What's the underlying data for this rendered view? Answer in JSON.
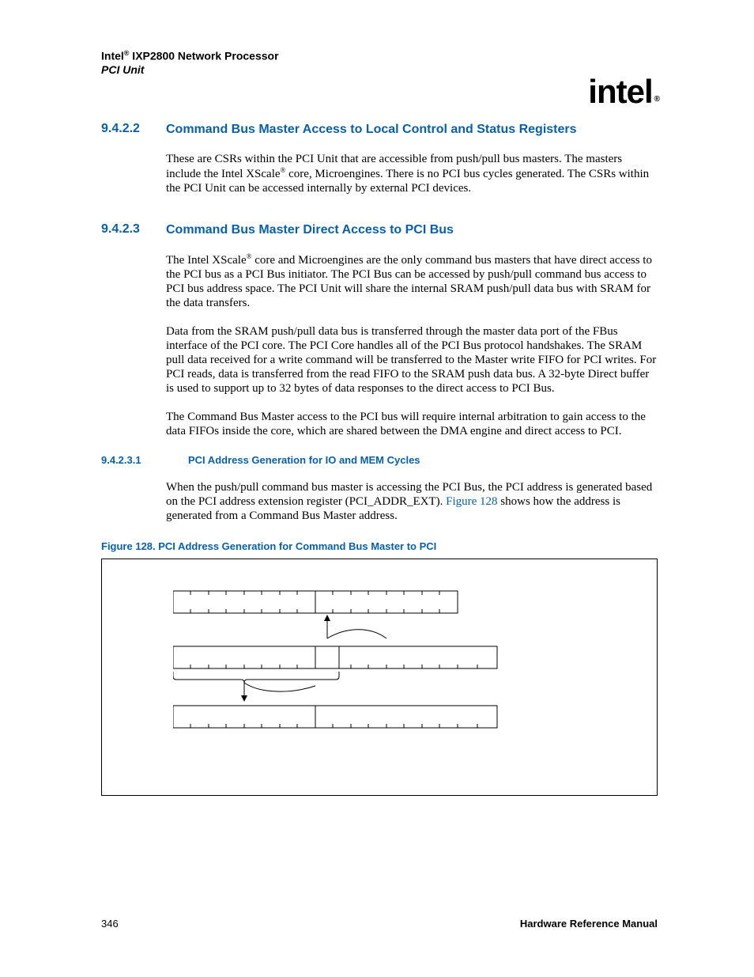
{
  "header": {
    "brand_prefix": "Intel",
    "reg_mark": "®",
    "product": " IXP2800 Network Processor",
    "subtitle": "PCI Unit"
  },
  "logo": {
    "text": "intel",
    "reg": "®"
  },
  "section_9422": {
    "num": "9.4.2.2",
    "title": "Command Bus Master Access to Local Control and Status Registers",
    "para1_a": "These are CSRs within the PCI Unit that are accessible from push/pull bus masters. The masters include the Intel XScale",
    "reg": "®",
    "para1_b": " core, Microengines. There is no PCI bus cycles generated. The CSRs within the PCI Unit can be accessed internally by external PCI devices."
  },
  "section_9423": {
    "num": "9.4.2.3",
    "title": "Command Bus Master Direct Access to PCI Bus",
    "para1_a": "The Intel XScale",
    "reg": "®",
    "para1_b": " core and Microengines are the only command bus masters that have direct access to the PCI bus as a PCI Bus initiator. The PCI Bus can be accessed by push/pull command bus access to PCI bus address space. The PCI Unit will share the internal SRAM push/pull data bus with SRAM for the data transfers.",
    "para2": "Data from the SRAM push/pull data bus is transferred through the master data port of the FBus interface of the PCI core. The PCI Core handles all of the PCI Bus protocol handshakes. The SRAM pull data received for a write command will be transferred to the Master write FIFO for PCI writes. For PCI reads, data is transferred from the read FIFO to the SRAM push data bus. A 32-byte Direct buffer is used to support up to 32 bytes of data responses to the direct access to PCI Bus.",
    "para3": "The Command Bus Master access to the PCI bus will require internal arbitration to gain access to the data FIFOs inside the core, which are shared between the DMA engine and direct access to PCI."
  },
  "section_94231": {
    "num": "9.4.2.3.1",
    "title": "PCI Address Generation for IO and MEM Cycles",
    "para1_a": "When the push/pull command bus master is accessing the PCI Bus, the PCI address is generated based on the PCI address extension register (PCI_ADDR_EXT). ",
    "figref": "Figure 128",
    "para1_b": " shows how the address is generated from a Command Bus Master address."
  },
  "figure128": {
    "title": "Figure 128. PCI Address Generation for Command Bus Master to PCI"
  },
  "footer": {
    "page": "346",
    "doc": "Hardware Reference Manual"
  }
}
